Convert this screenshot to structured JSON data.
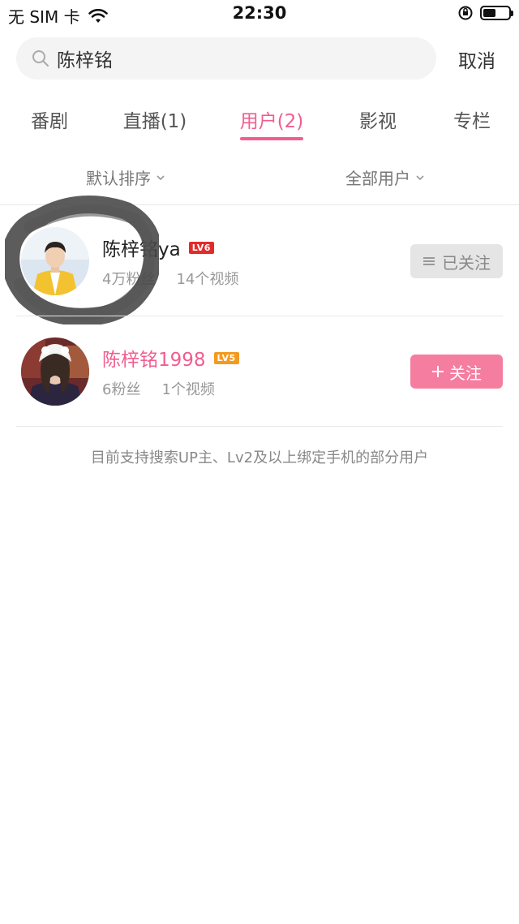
{
  "status_bar": {
    "carrier": "无 SIM 卡",
    "time": "22:30",
    "battery_level": 0.5
  },
  "search": {
    "query": "陈梓铭",
    "cancel_label": "取消"
  },
  "tabs": [
    {
      "label": "番剧",
      "active": false
    },
    {
      "label": "直播(1)",
      "active": false
    },
    {
      "label": "用户(2)",
      "active": true
    },
    {
      "label": "影视",
      "active": false
    },
    {
      "label": "专栏",
      "active": false
    }
  ],
  "filters": {
    "sort_label": "默认排序",
    "user_type_label": "全部用户"
  },
  "users": [
    {
      "name": "陈梓铭ya",
      "level": "LV6",
      "fans": "4万粉丝",
      "videos": "14个视频",
      "follow_label": "已关注",
      "followed": true
    },
    {
      "name": "陈梓铭1998",
      "level": "LV5",
      "fans": "6粉丝",
      "videos": "1个视频",
      "follow_label": "关注",
      "followed": false
    }
  ],
  "notice": "目前支持搜索UP主、Lv2及以上绑定手机的部分用户",
  "colors": {
    "accent": "#f25d8e",
    "follow_button": "#f57ea0",
    "lv6_badge": "#e22b2b",
    "lv5_badge": "#f39a1f"
  }
}
